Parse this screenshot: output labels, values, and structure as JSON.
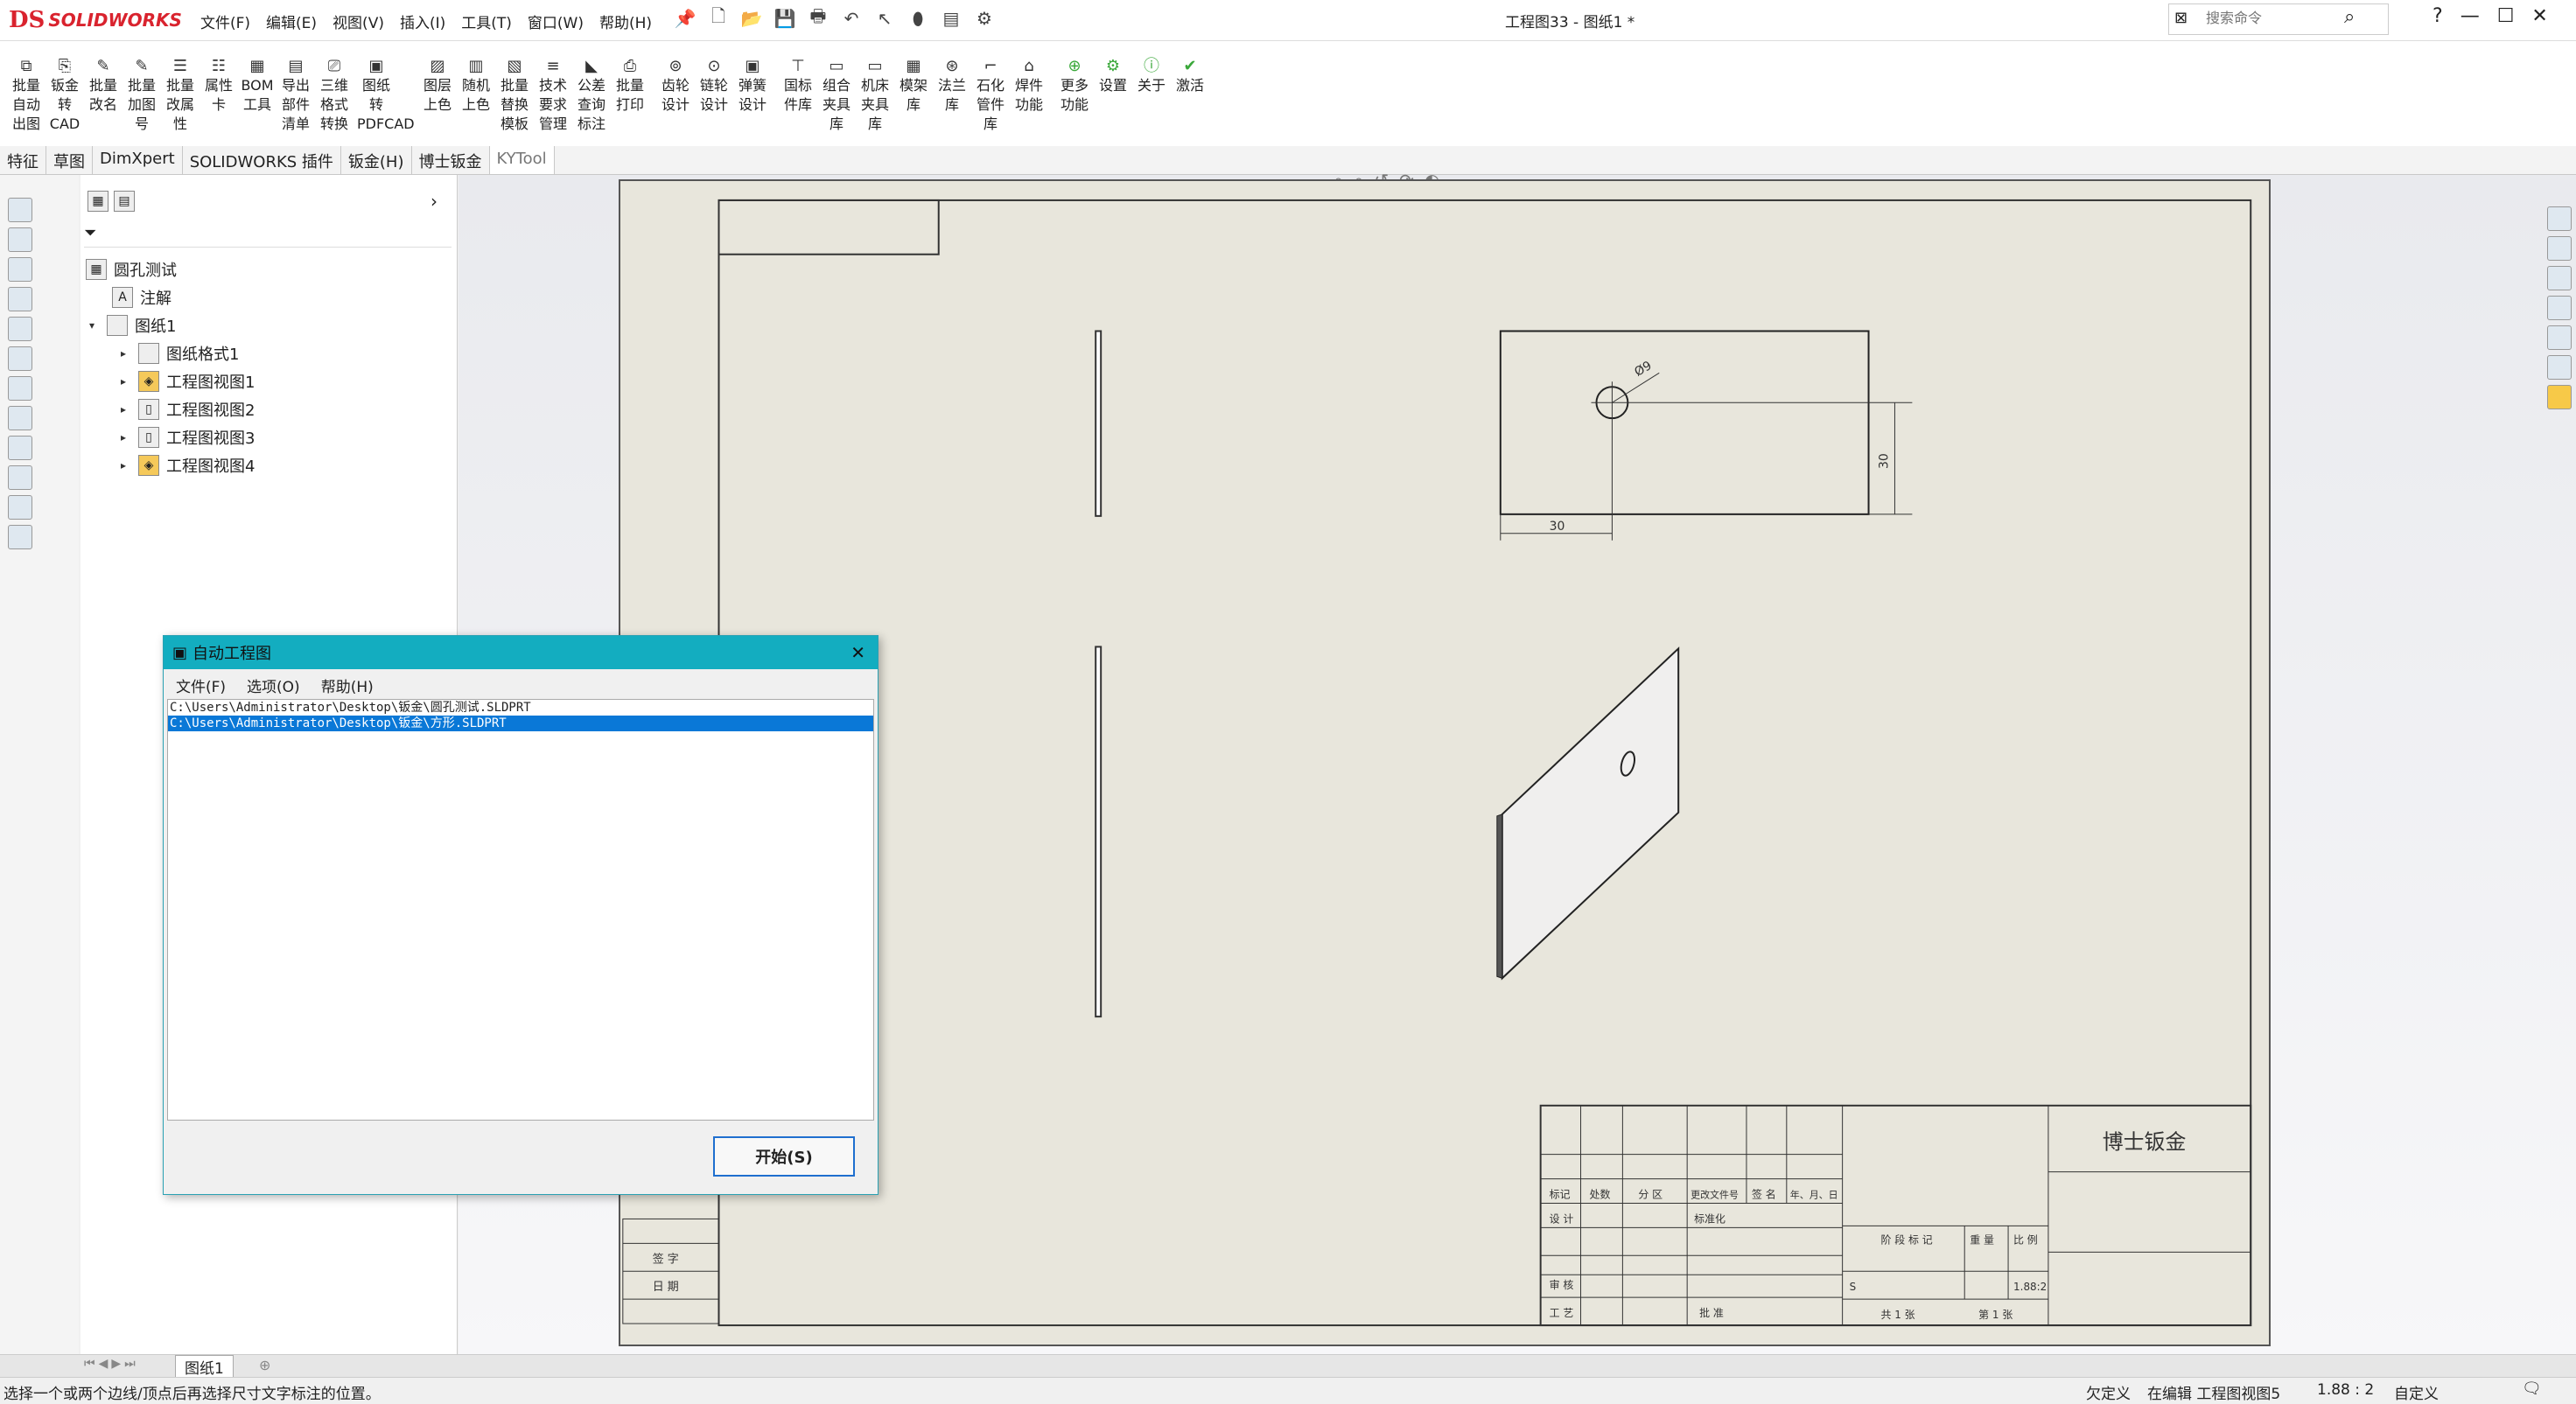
{
  "app": {
    "brand_ds": "DS",
    "brand_name": "SOLIDWORKS"
  },
  "menu": [
    "文件(F)",
    "编辑(E)",
    "视图(V)",
    "插入(I)",
    "工具(T)",
    "窗口(W)",
    "帮助(H)"
  ],
  "doc_title": "工程图33 - 图纸1 *",
  "search": {
    "placeholder": "搜索命令"
  },
  "commands": [
    [
      "批量",
      "自动",
      "出图"
    ],
    [
      "钣金",
      "转",
      "CAD"
    ],
    [
      "批量",
      "改名"
    ],
    [
      "批量",
      "加图",
      "号"
    ],
    [
      "批量",
      "改属",
      "性"
    ],
    [
      "属性",
      "卡"
    ],
    [
      "BOM",
      "工具"
    ],
    [
      "导出",
      "部件",
      "清单"
    ],
    [
      "三维",
      "格式",
      "转换"
    ],
    [
      "图纸转",
      "PDFCAD"
    ],
    [
      "图层",
      "上色"
    ],
    [
      "随机",
      "上色"
    ],
    [
      "批量",
      "替换",
      "模板"
    ],
    [
      "技术",
      "要求",
      "管理"
    ],
    [
      "公差",
      "查询",
      "标注"
    ],
    [
      "批量",
      "打印"
    ],
    [
      "齿轮",
      "设计"
    ],
    [
      "链轮",
      "设计"
    ],
    [
      "弹簧",
      "设计"
    ],
    [
      "国标",
      "件库"
    ],
    [
      "组合",
      "夹具",
      "库"
    ],
    [
      "机床",
      "夹具",
      "库"
    ],
    [
      "模架",
      "库"
    ],
    [
      "法兰",
      "库"
    ],
    [
      "石化",
      "管件",
      "库"
    ],
    [
      "焊件",
      "功能"
    ],
    [
      "更多",
      "功能"
    ],
    [
      "设置"
    ],
    [
      "关于"
    ],
    [
      "激活"
    ]
  ],
  "tabs": [
    "特征",
    "草图",
    "DimXpert",
    "SOLIDWORKS 插件",
    "钣金(H)",
    "博士钣金",
    "KYTool"
  ],
  "tree": {
    "root": "圆孔测试",
    "annotations": "注解",
    "sheet": "图纸1",
    "children": [
      "图纸格式1",
      "工程图视图1",
      "工程图视图2",
      "工程图视图3",
      "工程图视图4"
    ]
  },
  "dialog": {
    "title": "自动工程图",
    "menu": [
      "文件(F)",
      "选项(O)",
      "帮助(H)"
    ],
    "files": [
      "C:\\Users\\Administrator\\Desktop\\钣金\\圆孔测试.SLDPRT",
      "C:\\Users\\Administrator\\Desktop\\钣金\\方形.SLDPRT"
    ],
    "selected_index": 1,
    "start_label": "开始(S)"
  },
  "drawing": {
    "dim_diameter": "Ø9",
    "dim_vertical": "30",
    "dim_horizontal": "30",
    "titleblock_company": "博士钣金",
    "tb_headers": [
      "标记",
      "处数",
      "分 区",
      "更改文件号",
      "签 名",
      "年、月、日"
    ],
    "tb_design": "设 计",
    "tb_standard": "标准化",
    "tb_stage": "阶 段 标 记",
    "tb_weight": "重 量",
    "tb_scale": "比 例",
    "tb_stage_value": "S",
    "tb_scale_value": "1.88:2",
    "tb_review": "审 核",
    "tb_process": "工 艺",
    "tb_approve": "批 准",
    "tb_total": "共 1 张",
    "tb_page": "第 1 张",
    "left_sign": "签 字",
    "left_date": "日 期"
  },
  "sheet_tab": "图纸1",
  "status": {
    "message": "选择一个或两个边线/顶点后再选择尺寸文字标注的位置。",
    "state": "欠定义",
    "editing": "在编辑 工程图视图5",
    "scale": "1.88 : 2",
    "custom": "自定义"
  },
  "colors": {
    "brand": "#d9232e",
    "dialog_title": "#13adc0",
    "selection": "#0a78d7",
    "sheet": "#e8e6dc"
  }
}
